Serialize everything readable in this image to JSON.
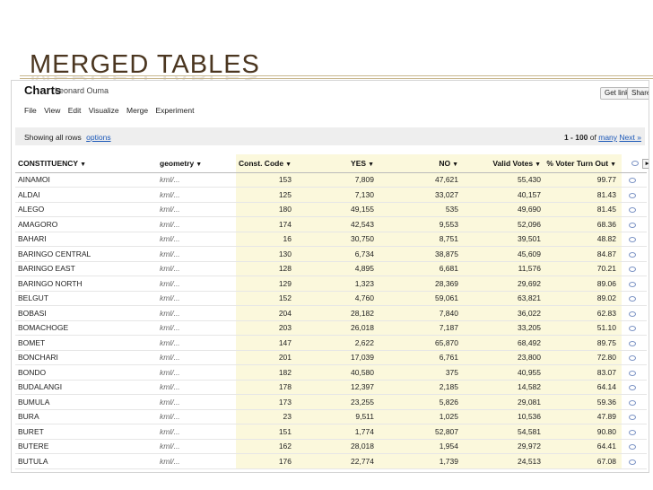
{
  "slide": {
    "title": "MERGED TABLES"
  },
  "app": {
    "title": "Charts",
    "user": "Leonard Ouma",
    "get_link": "Get link",
    "share": "Share"
  },
  "menu": [
    "File",
    "View",
    "Edit",
    "Visualize",
    "Merge",
    "Experiment"
  ],
  "status": {
    "showing": "Showing all rows",
    "options": "options",
    "range": "1 - 100",
    "of": "of",
    "many": "many",
    "next": "Next »"
  },
  "columns": [
    "CONSTITUENCY",
    "geometry",
    "Const. Code",
    "YES",
    "NO",
    "Valid Votes",
    "% Voter Turn Out"
  ],
  "geometry_value": "kml/...",
  "rows": [
    [
      "AINAMOI",
      "153",
      "7,809",
      "47,621",
      "55,430",
      "99.77"
    ],
    [
      "ALDAI",
      "125",
      "7,130",
      "33,027",
      "40,157",
      "81.43"
    ],
    [
      "ALEGO",
      "180",
      "49,155",
      "535",
      "49,690",
      "81.45"
    ],
    [
      "AMAGORO",
      "174",
      "42,543",
      "9,553",
      "52,096",
      "68.36"
    ],
    [
      "BAHARI",
      "16",
      "30,750",
      "8,751",
      "39,501",
      "48.82"
    ],
    [
      "BARINGO CENTRAL",
      "130",
      "6,734",
      "38,875",
      "45,609",
      "84.87"
    ],
    [
      "BARINGO EAST",
      "128",
      "4,895",
      "6,681",
      "11,576",
      "70.21"
    ],
    [
      "BARINGO NORTH",
      "129",
      "1,323",
      "28,369",
      "29,692",
      "89.06"
    ],
    [
      "BELGUT",
      "152",
      "4,760",
      "59,061",
      "63,821",
      "89.02"
    ],
    [
      "BOBASI",
      "204",
      "28,182",
      "7,840",
      "36,022",
      "62.83"
    ],
    [
      "BOMACHOGE",
      "203",
      "26,018",
      "7,187",
      "33,205",
      "51.10"
    ],
    [
      "BOMET",
      "147",
      "2,622",
      "65,870",
      "68,492",
      "89.75"
    ],
    [
      "BONCHARI",
      "201",
      "17,039",
      "6,761",
      "23,800",
      "72.80"
    ],
    [
      "BONDO",
      "182",
      "40,580",
      "375",
      "40,955",
      "83.07"
    ],
    [
      "BUDALANGI",
      "178",
      "12,397",
      "2,185",
      "14,582",
      "64.14"
    ],
    [
      "BUMULA",
      "173",
      "23,255",
      "5,826",
      "29,081",
      "59.36"
    ],
    [
      "BURA",
      "23",
      "9,511",
      "1,025",
      "10,536",
      "47.89"
    ],
    [
      "BURET",
      "151",
      "1,774",
      "52,807",
      "54,581",
      "90.80"
    ],
    [
      "BUTERE",
      "162",
      "28,018",
      "1,954",
      "29,972",
      "64.41"
    ],
    [
      "BUTULA",
      "176",
      "22,774",
      "1,739",
      "24,513",
      "67.08"
    ]
  ],
  "colors": {
    "title": "#4b3620",
    "link": "#1a57b8",
    "highlight": "#fbf8dc"
  },
  "icons": {
    "comment": "comment-icon",
    "caret": "caret-down-icon"
  }
}
